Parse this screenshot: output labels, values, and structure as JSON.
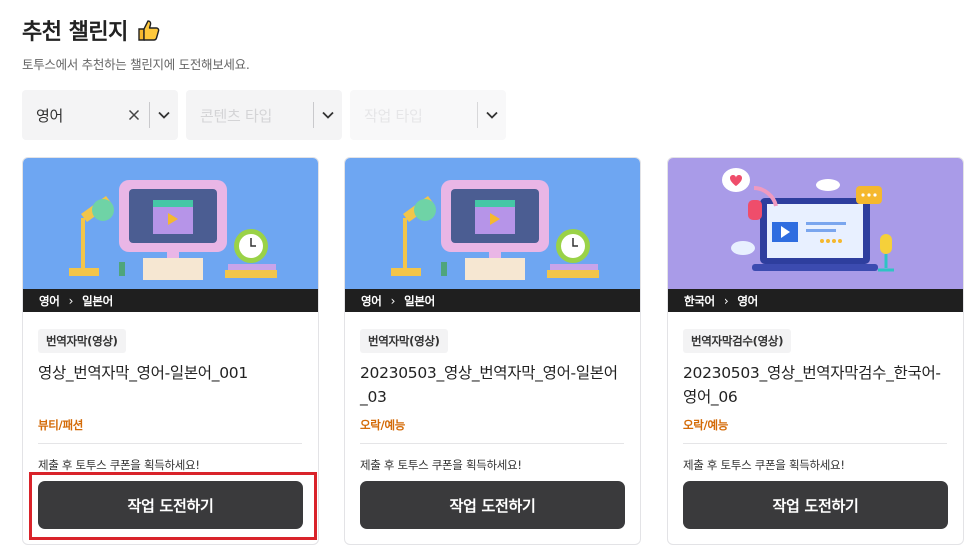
{
  "header": {
    "title": "추천 챌린지",
    "subtitle": "토투스에서 추천하는 챌린지에 도전해보세요."
  },
  "filters": [
    {
      "value": "영어",
      "has_clear": true
    },
    {
      "placeholder": "콘텐츠 타입"
    },
    {
      "placeholder": "작업 타입"
    }
  ],
  "cards": [
    {
      "source_lang": "영어",
      "target_lang": "일본어",
      "tag": "번역자막(영상)",
      "title": "영상_번역자막_영어-일본어_001",
      "category": "뷰티/패션",
      "reward_text": "제출 후 토투스 쿠폰을 획득하세요!",
      "cta_label": "작업 도전하기"
    },
    {
      "source_lang": "영어",
      "target_lang": "일본어",
      "tag": "번역자막(영상)",
      "title": "20230503_영상_번역자막_영어-일본어_03",
      "category": "오락/예능",
      "reward_text": "제출 후 토투스 쿠폰을 획득하세요!",
      "cta_label": "작업 도전하기"
    },
    {
      "source_lang": "한국어",
      "target_lang": "영어",
      "tag": "번역자막검수(영상)",
      "title": "20230503_영상_번역자막검수_한국어-영어_06",
      "category": "오락/예능",
      "reward_text": "제출 후 토투스 쿠폰을 획득하세요!",
      "cta_label": "작업 도전하기"
    }
  ],
  "colors": {
    "category": "#d46b08",
    "cta_bg": "#3a3a3c",
    "highlight": "#d9232a",
    "card_img_blue": "#6ea6f2",
    "card_img_purple": "#a99be8"
  },
  "icons": {
    "title": "thumbs-up-icon",
    "clear": "close-icon",
    "dropdown": "chevron-down-icon"
  }
}
